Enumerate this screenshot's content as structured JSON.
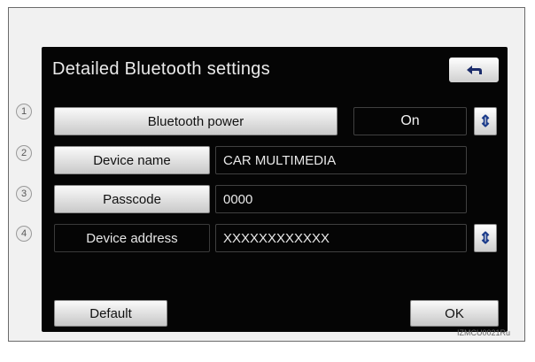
{
  "screen": {
    "title": "Detailed Bluetooth settings",
    "back_icon": "back-arrow-icon"
  },
  "rows": [
    {
      "label": "Bluetooth power",
      "value": "On"
    },
    {
      "label": "Device name",
      "value": "CAR MULTIMEDIA"
    },
    {
      "label": "Passcode",
      "value": "0000"
    },
    {
      "label": "Device address",
      "value": "XXXXXXXXXXXX"
    }
  ],
  "callouts": [
    "1",
    "2",
    "3",
    "4"
  ],
  "buttons": {
    "default_label": "Default",
    "ok_label": "OK"
  },
  "figure_code": "IZMCU0021Ru"
}
